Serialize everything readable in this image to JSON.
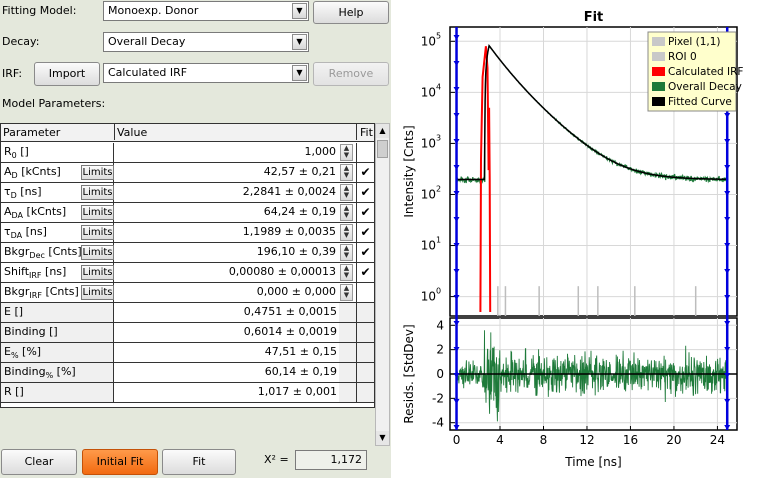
{
  "form": {
    "fitting_model_label": "Fitting Model:",
    "fitting_model_value": "Monoexp. Donor",
    "help_label": "Help",
    "decay_label": "Decay:",
    "decay_value": "Overall Decay",
    "irf_label": "IRF:",
    "import_label": "Import",
    "irf_value": "Calculated IRF",
    "remove_label": "Remove",
    "model_params_label": "Model Parameters:"
  },
  "table": {
    "headers": [
      "Parameter",
      "Value",
      "Fit"
    ],
    "rows": [
      {
        "name": "R",
        "sub": "0",
        "unit": "[]",
        "value": "1,000",
        "limits": "",
        "fit": "",
        "spin": true,
        "calc": false
      },
      {
        "name": "A",
        "sub": "D",
        "unit": "[kCnts]",
        "value": "42,57 ± 0,21",
        "limits": "Limits",
        "fit": "✔",
        "spin": true,
        "calc": false
      },
      {
        "name": "τ",
        "sub": "D",
        "unit": "[ns]",
        "value": "2,2841 ± 0,0024",
        "limits": "Limits",
        "fit": "✔",
        "spin": true,
        "calc": false
      },
      {
        "name": "A",
        "sub": "DA",
        "unit": "[kCnts]",
        "value": "64,24 ± 0,19",
        "limits": "Limits",
        "fit": "✔",
        "spin": true,
        "calc": false
      },
      {
        "name": "τ",
        "sub": "DA",
        "unit": "[ns]",
        "value": "1,1989 ± 0,0035",
        "limits": "Limits",
        "fit": "✔",
        "spin": true,
        "calc": false
      },
      {
        "name": "Bkgr",
        "sub": "Dec",
        "unit": "[Cnts]",
        "value": "196,10 ± 0,39",
        "limits": "Limits",
        "fit": "✔",
        "spin": true,
        "calc": false
      },
      {
        "name": "Shift",
        "sub": "IRF",
        "unit": "[ns]",
        "value": "0,00080 ± 0,00013",
        "limits": "Limits",
        "fit": "✔",
        "spin": true,
        "calc": false
      },
      {
        "name": "Bkgr",
        "sub": "IRF",
        "unit": "[Cnts]",
        "value": "0,000 ± 0,000",
        "limits": "Limits",
        "fit": "",
        "spin": true,
        "calc": false
      },
      {
        "name": "E",
        "sub": "",
        "unit": "[]",
        "value": "0,4751 ± 0,0015",
        "limits": "",
        "fit": "",
        "spin": false,
        "calc": true
      },
      {
        "name": "Binding",
        "sub": "",
        "unit": "[]",
        "value": "0,6014 ± 0,0019",
        "limits": "",
        "fit": "",
        "spin": false,
        "calc": true
      },
      {
        "name": "E",
        "sub": "%",
        "unit": "[%]",
        "value": "47,51 ± 0,15",
        "limits": "",
        "fit": "",
        "spin": false,
        "calc": true
      },
      {
        "name": "Binding",
        "sub": "%",
        "unit": "[%]",
        "value": "60,14 ± 0,19",
        "limits": "",
        "fit": "",
        "spin": false,
        "calc": true
      },
      {
        "name": "R",
        "sub": "",
        "unit": "[]",
        "value": "1,017 ± 0,001",
        "limits": "",
        "fit": "",
        "spin": false,
        "calc": true
      }
    ]
  },
  "buttons": {
    "clear": "Clear",
    "initial_fit": "Initial Fit",
    "fit": "Fit"
  },
  "chi": {
    "label": "Χ² =",
    "value": "1,172"
  },
  "chart_data": {
    "type": "line",
    "title": "Fit",
    "xlabel": "Time [ns]",
    "ylabel": "Intensity [Cnts]",
    "ylabel2": "Resids. [StdDev]",
    "xlim": [
      -0.6,
      25.8
    ],
    "xticks": [
      "0",
      "4",
      "8",
      "12",
      "16",
      "20",
      "24"
    ],
    "ylim_log": [
      0.6,
      1.2
    ],
    "yscale": "log",
    "yticks_log": [
      {
        "base": "10",
        "exp": "0"
      },
      {
        "base": "10",
        "exp": "1"
      },
      {
        "base": "10",
        "exp": "2"
      },
      {
        "base": "10",
        "exp": "3"
      },
      {
        "base": "10",
        "exp": "4"
      },
      {
        "base": "10",
        "exp": "5"
      }
    ],
    "ylim_resid": [
      -4.6,
      4.6
    ],
    "yticks_resid": [
      "4",
      "2",
      "0",
      "-2",
      "-4"
    ],
    "legend": {
      "placement": "top-right",
      "entries": [
        {
          "label": "Pixel (1,1)",
          "color": "#c8c8c8"
        },
        {
          "label": "ROI 0",
          "color": "#c8c8c8"
        },
        {
          "label": "Calculated IRF",
          "color": "#ff0000"
        },
        {
          "label": "Overall Decay",
          "color": "#1e7a3a"
        },
        {
          "label": "Fitted Curve",
          "color": "#000000"
        }
      ]
    },
    "fit_params": {
      "t0": 2.6,
      "rise_end": 3.0,
      "A1": 42570,
      "tau1": 2.2841,
      "A2": 64240,
      "tau2": 1.1989,
      "bkgr": 196.1
    },
    "irf": {
      "start": 2.2,
      "peak": 2.7,
      "end": 3.1,
      "peak_value": 80000
    },
    "cursor_x": [
      0.0,
      24.9
    ],
    "colors": {
      "decay": "#1e7a3a",
      "fit": "#000000",
      "irf": "#ff0000",
      "cursor": "#0000dd"
    }
  }
}
